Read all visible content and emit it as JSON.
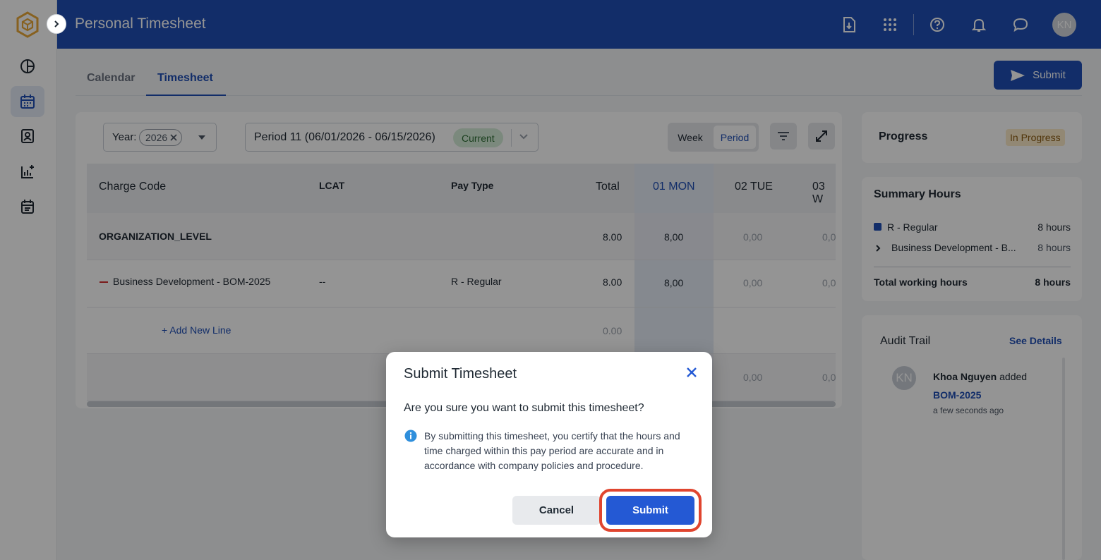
{
  "header": {
    "title": "Personal Timesheet",
    "avatar_initials": "KN"
  },
  "colors": {
    "brand": "#1f4fb5",
    "submit": "#2459d4",
    "highlight": "#e0452f",
    "logo": "#e8a838"
  },
  "tabs": [
    {
      "label": "Calendar"
    },
    {
      "label": "Timesheet",
      "active": true
    }
  ],
  "toolbar": {
    "submit_label": "Submit",
    "year_label": "Year:",
    "year_value": "2026",
    "period_label": "Period 11 (06/01/2026 - 06/15/2026)",
    "period_status": "Current",
    "view_week": "Week",
    "view_period": "Period",
    "active_view": "Period"
  },
  "table": {
    "columns": {
      "charge_code": "Charge Code",
      "lcat": "LCAT",
      "pay_type": "Pay Type",
      "total": "Total",
      "day1": "01 MON",
      "day2": "02 TUE",
      "day3": "03 W"
    },
    "org_row": {
      "charge_code": "ORGANIZATION_LEVEL",
      "total": "8.00",
      "day1": "8,00",
      "day2": "0,00",
      "day3": "0,0"
    },
    "line_row": {
      "charge_code": "Business Development - BOM-2025",
      "lcat": "--",
      "pay_type": "R - Regular",
      "total": "8.00",
      "day1": "8,00",
      "day2": "0,00",
      "day3": "0,0"
    },
    "add_row": {
      "label": "+ Add New Line",
      "total": "0.00"
    },
    "totals_row": {
      "day2": "0,00",
      "day3": "0,0"
    }
  },
  "progress": {
    "title": "Progress",
    "status": "In Progress"
  },
  "summary": {
    "title": "Summary Hours",
    "items": [
      {
        "label": "R - Regular",
        "hours": "8 hours"
      },
      {
        "label": "Business Development - B...",
        "hours": "8 hours"
      }
    ],
    "total_label": "Total working hours",
    "total_hours": "8 hours"
  },
  "audit": {
    "title": "Audit Trail",
    "see_details": "See Details",
    "entry": {
      "initials": "KN",
      "user": "Khoa Nguyen",
      "action": "added",
      "target": "BOM-2025",
      "time": "a few seconds ago"
    }
  },
  "modal": {
    "title": "Submit Timesheet",
    "question": "Are you sure you want to submit this timesheet?",
    "description": "By submitting this timesheet, you certify that the hours and time charged within this pay period are accurate and in accordance with company policies and procedure.",
    "cancel_label": "Cancel",
    "submit_label": "Submit"
  }
}
